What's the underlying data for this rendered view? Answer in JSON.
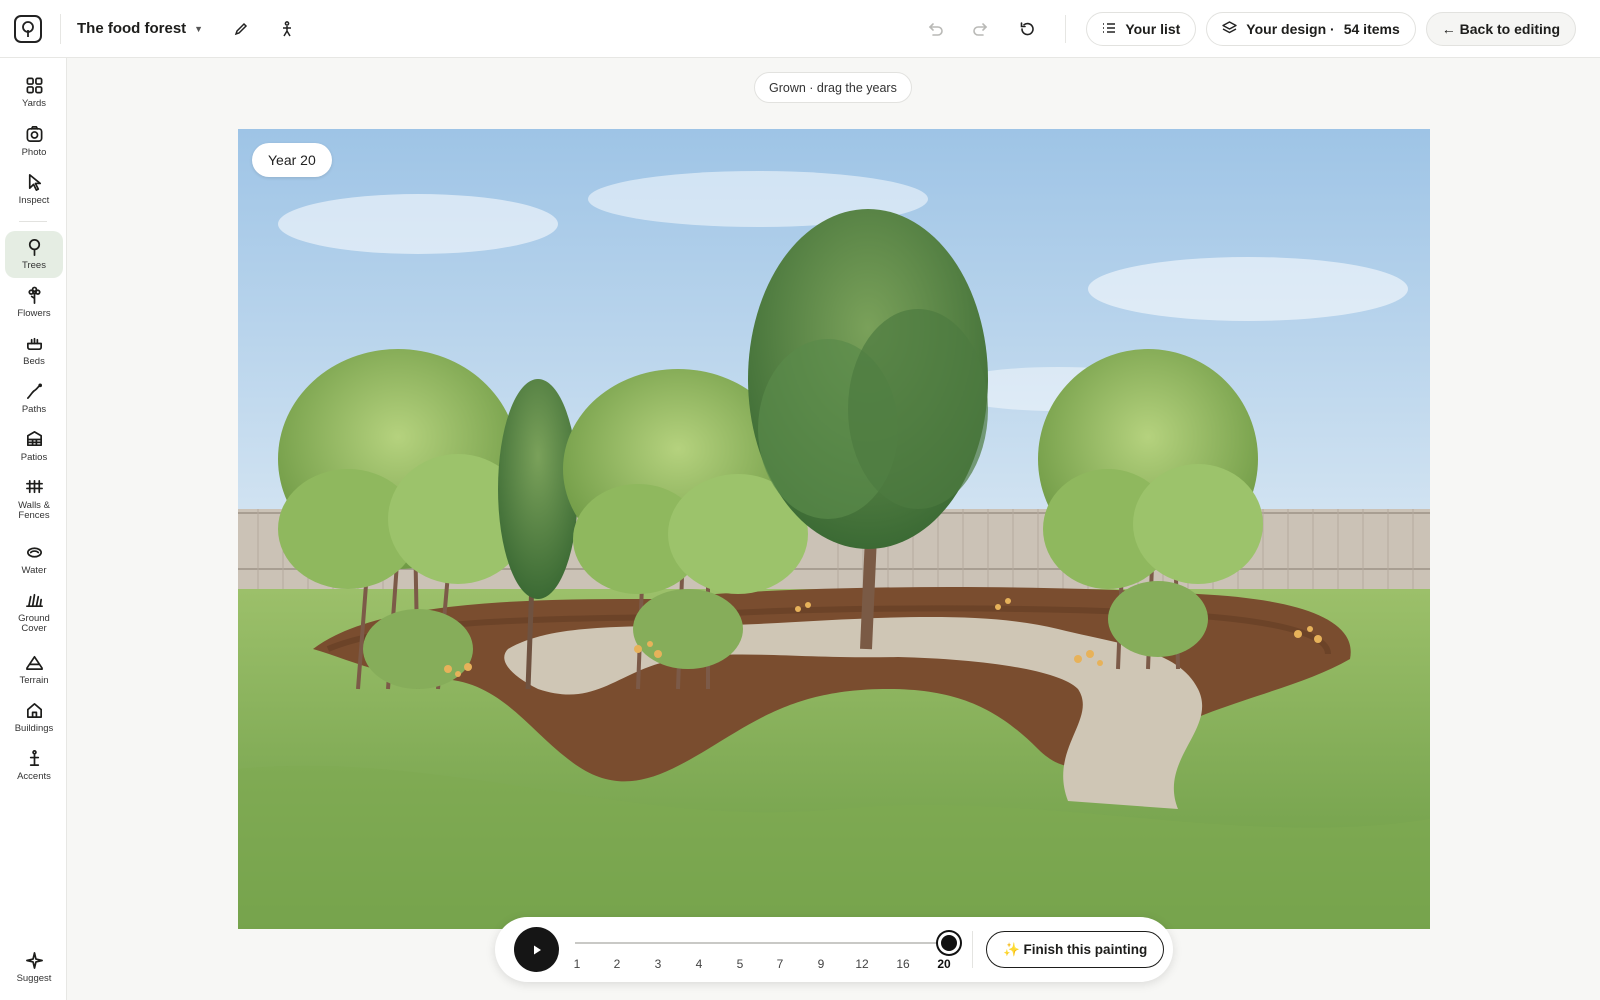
{
  "header": {
    "project_name": "The food forest",
    "your_list_label": "Your list",
    "your_design_label": "Your design ·",
    "item_count": "54 items",
    "back_label": "← Back to editing"
  },
  "sidebar": {
    "items": [
      {
        "label": "Yards",
        "icon": "yards-icon"
      },
      {
        "label": "Photo",
        "icon": "camera-icon"
      },
      {
        "label": "Inspect",
        "icon": "cursor-icon"
      },
      {
        "label": "Trees",
        "icon": "tree-icon"
      },
      {
        "label": "Flowers",
        "icon": "flower-icon"
      },
      {
        "label": "Beds",
        "icon": "bed-icon"
      },
      {
        "label": "Paths",
        "icon": "path-icon"
      },
      {
        "label": "Patios",
        "icon": "patio-icon"
      },
      {
        "label": "Walls & Fences",
        "icon": "fence-icon"
      },
      {
        "label": "Water",
        "icon": "water-icon"
      },
      {
        "label": "Ground Cover",
        "icon": "ground-cover-icon"
      },
      {
        "label": "Terrain",
        "icon": "terrain-icon"
      },
      {
        "label": "Buildings",
        "icon": "building-icon"
      },
      {
        "label": "Accents",
        "icon": "accent-icon"
      }
    ],
    "active": "Trees",
    "suggest_label": "Suggest"
  },
  "main": {
    "grown_hint": "Grown · drag the years",
    "year_badge": "Year 20"
  },
  "timeline": {
    "years": [
      "1",
      "2",
      "3",
      "4",
      "5",
      "7",
      "9",
      "12",
      "16",
      "20"
    ],
    "selected_year": "20",
    "finish_label": "✨ Finish this painting"
  },
  "colors": {
    "accent_active": "#e5ede3",
    "dark": "#151515"
  }
}
